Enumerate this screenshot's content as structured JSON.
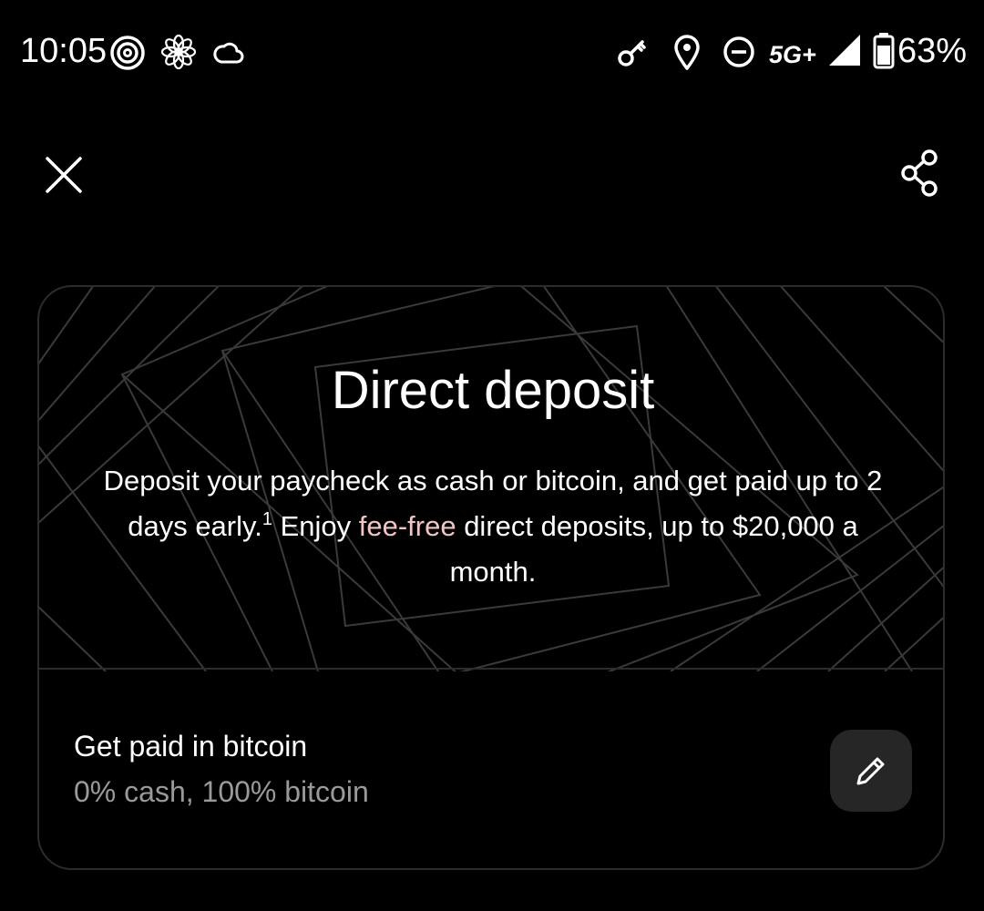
{
  "status_bar": {
    "time": "10:05",
    "network": "5G+",
    "battery": "63%",
    "icons": [
      "threads-icon",
      "flower-icon",
      "cloud-icon",
      "key-icon",
      "location-pin-icon",
      "do-not-disturb-icon",
      "signal-icon",
      "battery-icon"
    ]
  },
  "top_bar": {
    "close_icon": "close-icon",
    "share_icon": "share-icon"
  },
  "card": {
    "title": "Direct deposit",
    "desc_part1": "Deposit your paycheck as cash or bitcoin, and get paid up to 2 days early.",
    "footnote": "1",
    "desc_part2": " Enjoy ",
    "fee_link": "fee-free",
    "desc_part3": " direct deposits, up to $20,000 a month.",
    "link_color": "#f2c4c6"
  },
  "setting": {
    "title": "Get paid in bitcoin",
    "subtitle": "0% cash, 100% bitcoin",
    "edit_icon": "pencil-icon"
  }
}
